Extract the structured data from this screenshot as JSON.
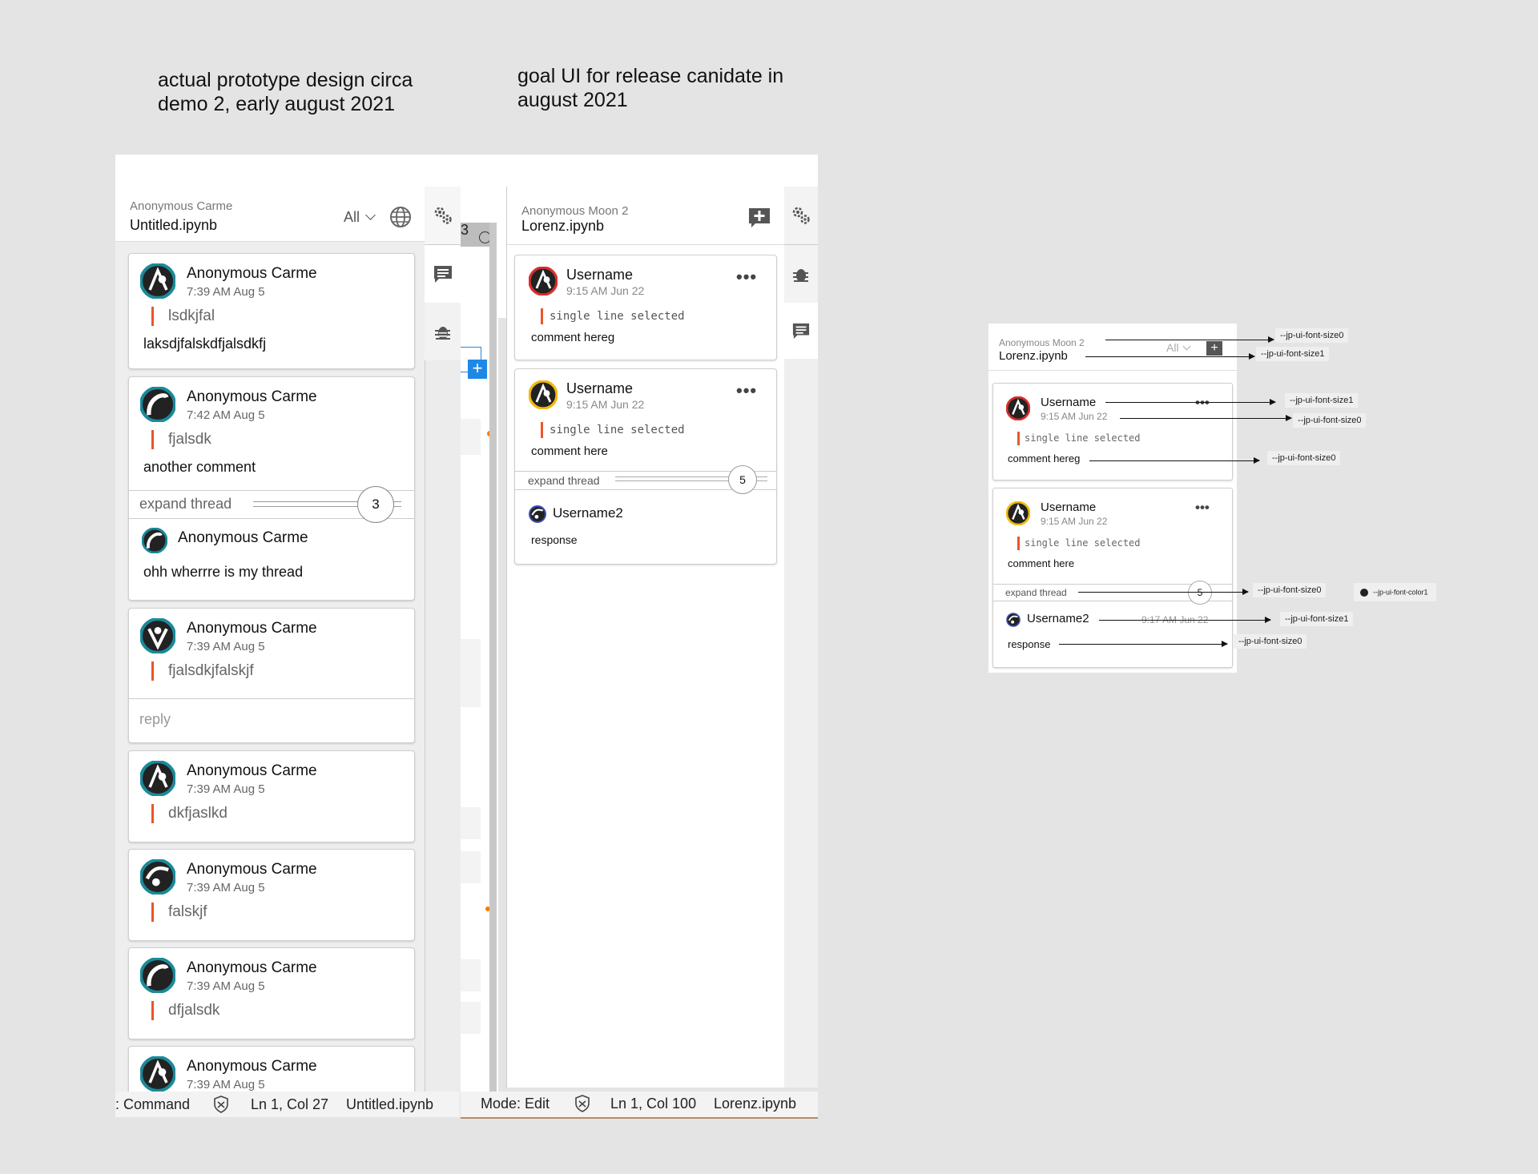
{
  "captions": {
    "left": [
      "actual prototype design circa",
      "demo 2, early august 2021"
    ],
    "right": [
      "goal UI for release canidate in",
      "august 2021"
    ]
  },
  "proto": {
    "author": "Anonymous Carme",
    "file": "Untitled.ipynb",
    "filter": "All",
    "peek_number": "3",
    "comments": [
      {
        "name": "Anonymous Carme",
        "time": "7:39 AM Aug 5",
        "quote": "lsdkjfal",
        "text": "laksdjfalskdfjalsdkfj"
      },
      {
        "name": "Anonymous Carme",
        "time": "7:42 AM Aug 5",
        "quote": "fjalsdk",
        "text": "another comment",
        "expand": "expand thread",
        "count": "3",
        "reply_name": "Anonymous Carme",
        "reply_text": "ohh wherrre is my thread"
      },
      {
        "name": "Anonymous Carme",
        "time": "7:39 AM Aug 5",
        "quote": "fjalsdkjfalskjf",
        "reply_placeholder": "reply"
      },
      {
        "name": "Anonymous Carme",
        "time": "7:39 AM Aug 5",
        "quote": "dkfjaslkd"
      },
      {
        "name": "Anonymous Carme",
        "time": "7:39 AM Aug 5",
        "quote": "falskjf"
      },
      {
        "name": "Anonymous Carme",
        "time": "7:39 AM Aug 5",
        "quote": "dfjalsdk"
      },
      {
        "name": "Anonymous Carme",
        "time": "7:39 AM Aug 5"
      }
    ],
    "status": {
      "mode": ": Command",
      "pos": "Ln 1, Col 27",
      "file": "Untitled.ipynb"
    }
  },
  "goal": {
    "author": "Anonymous Moon 2",
    "file": "Lorenz.ipynb",
    "comments": [
      {
        "name": "Username",
        "time": "9:15 AM Jun 22",
        "quote": "single line selected",
        "text": "comment hereg"
      },
      {
        "name": "Username",
        "time": "9:15 AM Jun 22",
        "quote": "single line selected",
        "text": "comment here",
        "expand": "expand thread",
        "count": "5",
        "reply_name": "Username2",
        "reply_text": "response"
      }
    ],
    "status": {
      "mode": "Mode: Edit",
      "pos": "Ln 1, Col 100",
      "file": "Lorenz.ipynb"
    }
  },
  "annotated": {
    "author": "Anonymous Moon 2",
    "file": "Lorenz.ipynb",
    "filter": "All",
    "comments": [
      {
        "name": "Username",
        "time": "9:15 AM Jun 22",
        "quote": "single line selected",
        "text": "comment hereg"
      },
      {
        "name": "Username",
        "time": "9:15 AM Jun 22",
        "quote": "single line selected",
        "text": "comment here",
        "expand": "expand thread",
        "count": "5",
        "reply_name": "Username2",
        "reply_time": "9:17 AM Jun 22",
        "reply_text": "response"
      }
    ],
    "labels": {
      "author": "--jp-ui-font-size0",
      "file": "--jp-ui-font-size1",
      "name": "--jp-ui-font-size1",
      "time": "--jp-ui-font-size0",
      "text": "--jp-ui-font-size0",
      "expand": "--jp-ui-font-size0",
      "color": "--jp-ui-font-color1",
      "reply_name": "--jp-ui-font-size1",
      "reply_text": "--jp-ui-font-size0"
    }
  },
  "colors": {
    "accent_orange": "#e8572a",
    "plus_blue": "#1e88e5",
    "avatar_teal": "#1a8a9a",
    "avatar_red": "#d9302c",
    "avatar_yellow": "#f2b90f",
    "avatar_blue": "#3d4fb5"
  }
}
